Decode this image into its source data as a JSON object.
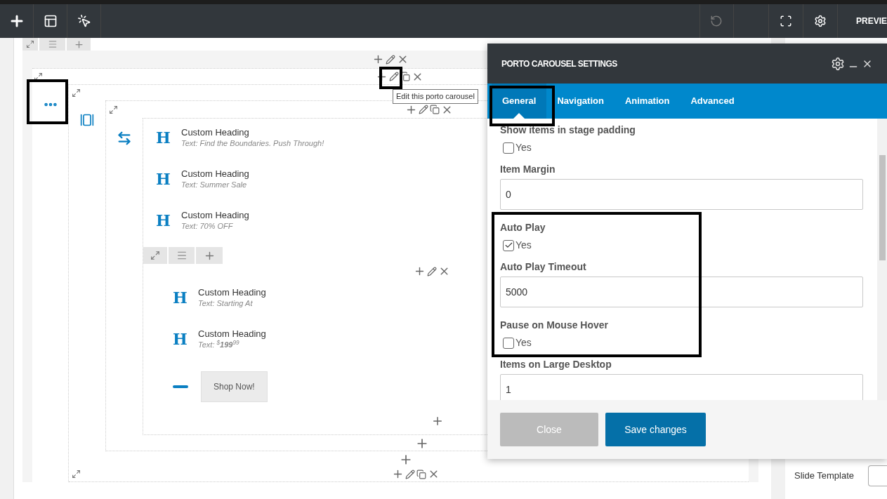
{
  "topbar": {
    "preview": "PREVIE"
  },
  "tooltip": "Edit this porto carousel",
  "elements": [
    {
      "kind": "heading",
      "icon": "H",
      "title": "Custom Heading",
      "text": "Text: Find the Boundaries. Push Through!"
    },
    {
      "kind": "heading",
      "icon": "H",
      "title": "Custom Heading",
      "text": "Text: Summer Sale"
    },
    {
      "kind": "heading",
      "icon": "H",
      "title": "Custom Heading",
      "text": "Text: 70% OFF"
    }
  ],
  "nested_elements": [
    {
      "kind": "heading",
      "icon": "H",
      "title": "Custom Heading",
      "text": "Text: Starting At"
    },
    {
      "kind": "price",
      "icon": "H",
      "title": "Custom Heading",
      "prefix": "Text: ",
      "currency": "$",
      "amount": "199",
      "cents": "99"
    },
    {
      "kind": "button",
      "label": "Shop Now!"
    }
  ],
  "dialog": {
    "title": "PORTO CAROUSEL SETTINGS",
    "tabs": [
      {
        "label": "General",
        "selected": true
      },
      {
        "label": "Navigation",
        "selected": false
      },
      {
        "label": "Animation",
        "selected": false
      },
      {
        "label": "Advanced",
        "selected": false
      }
    ],
    "fields": [
      {
        "kind": "checkbox",
        "label": "Show items in stage padding",
        "option": "Yes",
        "checked": false
      },
      {
        "kind": "text",
        "label": "Item Margin",
        "value": "0"
      },
      {
        "kind": "checkbox",
        "label": "Auto Play",
        "option": "Yes",
        "checked": true
      },
      {
        "kind": "text",
        "label": "Auto Play Timeout",
        "value": "5000"
      },
      {
        "kind": "checkbox",
        "label": "Pause on Mouse Hover",
        "option": "Yes",
        "checked": false
      },
      {
        "kind": "text",
        "label": "Items on Large Desktop",
        "value": "1"
      }
    ],
    "buttons": [
      {
        "kind": "secondary",
        "label": "Close"
      },
      {
        "kind": "primary",
        "label": "Save changes"
      }
    ]
  },
  "sidebar": {
    "field_label": "Slide Template"
  }
}
